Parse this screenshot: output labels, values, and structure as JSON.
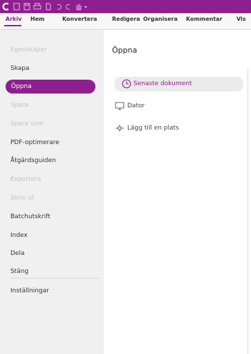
{
  "colors": {
    "accent": "#8e1f8f",
    "sidebar_bg": "#f0f0f0",
    "disabled_text": "#c2c2c2"
  },
  "quick_access": [
    "app-logo-icon",
    "new-document-icon",
    "save-icon",
    "print-icon",
    "page-icon",
    "undo-icon",
    "redo-icon",
    "hand-tool-icon",
    "customize-dropdown-icon"
  ],
  "ribbon": {
    "tabs": [
      "Arkiv",
      "Hem",
      "Konvertera",
      "Redigera",
      "Organisera",
      "Kommentar",
      "Vis"
    ],
    "active_tab": "Arkiv"
  },
  "sidebar": {
    "items": [
      {
        "label": "Egenskaper",
        "state": "disabled"
      },
      {
        "label": "Skapa",
        "state": "normal"
      },
      {
        "label": "Öppna",
        "state": "active"
      },
      {
        "label": "Spara",
        "state": "disabled"
      },
      {
        "label": "Spara som",
        "state": "disabled"
      },
      {
        "label": "PDF-optimerare",
        "state": "normal"
      },
      {
        "label": "Åtgärdsguiden",
        "state": "normal"
      },
      {
        "label": "Exportera",
        "state": "disabled"
      },
      {
        "label": "Skriv ut",
        "state": "disabled"
      },
      {
        "label": "Batchutskrift",
        "state": "normal"
      },
      {
        "label": "Index",
        "state": "normal"
      },
      {
        "label": "Dela",
        "state": "normal"
      },
      {
        "label": "Stäng",
        "state": "normal"
      },
      {
        "label": "Inställningar",
        "state": "normal"
      }
    ]
  },
  "main": {
    "title": "Öppna",
    "locations": [
      {
        "label": "Senaste dokument",
        "icon": "clock-icon",
        "selected": true
      },
      {
        "label": "Dator",
        "icon": "computer-icon",
        "selected": false
      },
      {
        "label": "Lägg till en plats",
        "icon": "add-place-icon",
        "selected": false
      }
    ]
  }
}
